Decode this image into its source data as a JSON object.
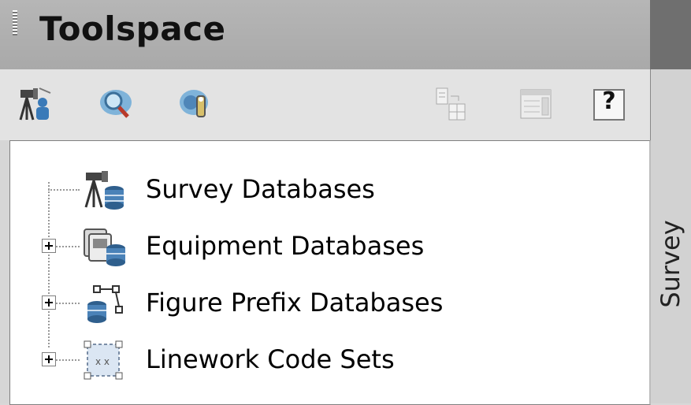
{
  "panel": {
    "title": "Toolspace",
    "side_tab": "Survey"
  },
  "toolbar": {
    "left_icons": [
      "survey-equipment-icon",
      "search-icon",
      "settings-icon"
    ],
    "right_icons": [
      "copy-to-layout-icon",
      "properties-icon",
      "help-icon"
    ],
    "help_label": "?"
  },
  "tree": {
    "items": [
      {
        "label": "Survey Databases",
        "expandable": false,
        "icon": "survey-database-icon"
      },
      {
        "label": "Equipment Databases",
        "expandable": true,
        "icon": "equipment-database-icon"
      },
      {
        "label": "Figure Prefix Databases",
        "expandable": true,
        "icon": "figure-prefix-database-icon"
      },
      {
        "label": "Linework Code Sets",
        "expandable": true,
        "icon": "linework-code-set-icon"
      }
    ]
  }
}
